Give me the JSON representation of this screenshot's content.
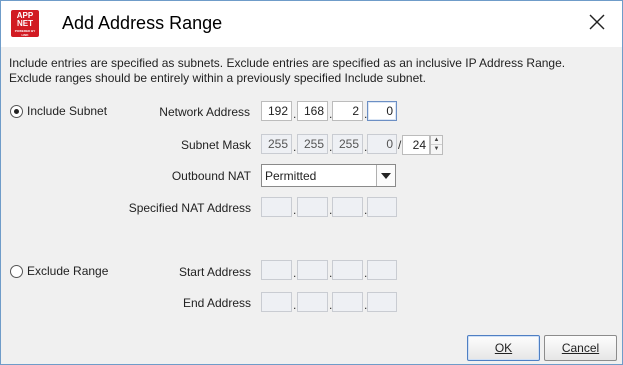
{
  "window": {
    "title": "Add Address Range",
    "logo": {
      "line1": "APP",
      "line2": "NET",
      "line3": "POWERED BY LINK"
    }
  },
  "description": {
    "line1": "Include entries are specified as subnets.  Exclude entries are specified as an inclusive IP Address Range.",
    "line2": "Exclude ranges should be entirely within a previously specified Include subnet."
  },
  "include": {
    "radio_label": "Include Subnet",
    "selected": true,
    "network_address": {
      "label": "Network Address",
      "octets": [
        "192",
        "168",
        "2",
        "0"
      ]
    },
    "subnet_mask": {
      "label": "Subnet Mask",
      "octets": [
        "255",
        "255",
        "255",
        "0"
      ],
      "prefix_separator": "/",
      "prefix": "24"
    },
    "outbound_nat": {
      "label": "Outbound NAT",
      "value": "Permitted"
    },
    "nat_address": {
      "label": "Specified NAT Address",
      "octets": [
        "",
        "",
        "",
        ""
      ]
    }
  },
  "exclude": {
    "radio_label": "Exclude Range",
    "selected": false,
    "start_address": {
      "label": "Start Address",
      "octets": [
        "",
        "",
        "",
        ""
      ]
    },
    "end_address": {
      "label": "End Address",
      "octets": [
        "",
        "",
        "",
        ""
      ]
    }
  },
  "buttons": {
    "ok": "OK",
    "cancel": "Cancel"
  },
  "ip_dot": "."
}
